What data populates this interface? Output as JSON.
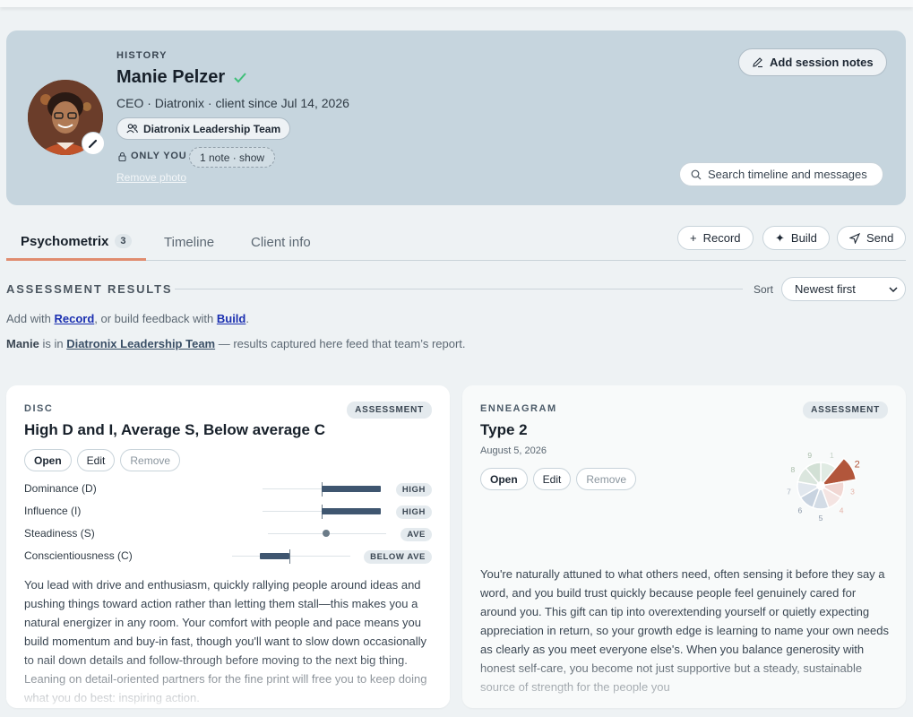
{
  "header": {
    "eyebrow": "HISTORY",
    "name": "Manie Pelzer",
    "subtitle": "CEO · Diatronix · client since Jul 14, 2026",
    "team": "Diatronix Leadership Team",
    "privacy": "ONLY YOU",
    "notes": "1 note · show",
    "remove_photo": "Remove photo",
    "add_notes": "Add session notes",
    "search": "Search timeline and messages"
  },
  "tabs": [
    {
      "label": "Psychometrix",
      "count": "3"
    },
    {
      "label": "Timeline"
    },
    {
      "label": "Client info"
    }
  ],
  "actions": {
    "record": "Record",
    "build": "Build",
    "send": "Send"
  },
  "section": {
    "title": "ASSESSMENT RESULTS",
    "sort_label": "Sort",
    "sort_value": "Newest first",
    "help_prefix": "Add with ",
    "help_record": "Record",
    "help_mid": ", or build feedback with ",
    "help_build": "Build",
    "help_end": ".",
    "team_name_first": "Manie",
    "team_is_in": " is in ",
    "team_link": "Diatronix Leadership Team",
    "team_suffix": " — results captured here feed that team’s report."
  },
  "cards": [
    {
      "eyebrow": "DISC",
      "badge": "ASSESSMENT",
      "title": "High D and I, Average S, Below average C",
      "buttons": {
        "open": "Open",
        "edit": "Edit",
        "remove": "Remove"
      },
      "scales": [
        {
          "label": "Dominance (D)",
          "level": "HIGH"
        },
        {
          "label": "Influence (I)",
          "level": "HIGH"
        },
        {
          "label": "Steadiness (S)",
          "level": "AVE"
        },
        {
          "label": "Conscientiousness (C)",
          "level": "BELOW AVE"
        }
      ],
      "body": "You lead with drive and enthusiasm, quickly rallying people around ideas and pushing things toward action rather than letting them stall—this makes you a natural energizer in any room. Your comfort with people and pace means you build momentum and buy-in fast, though you'll want to slow down occasionally to nail down details and follow-through before moving to the next big thing. Leaning on detail-oriented partners for the fine print will free you to keep doing what you do best: inspiring action."
    },
    {
      "eyebrow": "ENNEAGRAM",
      "badge": "ASSESSMENT",
      "title": "Type 2",
      "date": "August 5, 2026",
      "buttons": {
        "open": "Open",
        "edit": "Edit",
        "remove": "Remove"
      },
      "wheel_labels": [
        "1",
        "2",
        "3",
        "4",
        "5",
        "6",
        "7",
        "8",
        "9"
      ],
      "wheel_highlight": "2",
      "body": "You're naturally attuned to what others need, often sensing it before they say a word, and you build trust quickly because people feel genuinely cared for around you. This gift can tip into overextending yourself or quietly expecting appreciation in return, so your growth edge is learning to name your own needs as clearly as you meet everyone else's. When you balance generosity with honest self-care, you become not just supportive but a steady, sustainable source of strength for the people you"
    }
  ]
}
